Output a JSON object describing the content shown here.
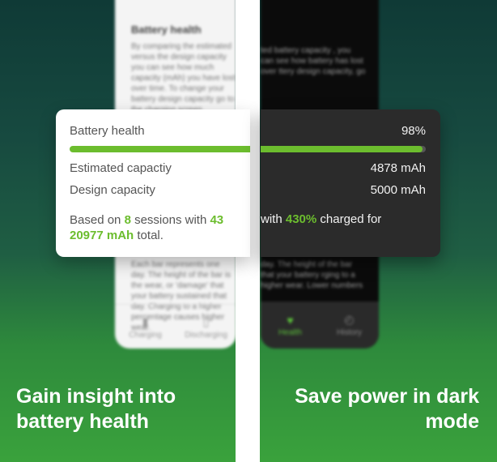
{
  "left_phone": {
    "doc_title": "Battery health",
    "doc_text": "By comparing the estimated versus the design capacity you can see how much capacity (mAh) you have lost over time. To change your battery design capacity go to the charging screen.",
    "doc_text_2": "Each bar represents one day. The height of the bar is the wear, or 'damage' that your battery sustained that day. Charging to a higher percentage causes higher wear.",
    "nav": [
      "Charging",
      "Discharging"
    ]
  },
  "right_phone": {
    "doc_text": "ted battery capacity , you can see how battery has lost over ttery design capacity, go",
    "doc_text_2": "day. The height of the bar that your battery rging to a higher wear. Lower numbers",
    "nav": [
      "Health",
      "History"
    ]
  },
  "card": {
    "title": "Battery health",
    "percent": "98%",
    "percent_value": 98,
    "estimated_label": "Estimated capactiy",
    "estimated_value": "4878 mAh",
    "design_label": "Design capacity",
    "design_value": "5000 mAh",
    "based_on": "Based on",
    "sessions_count": "8",
    "sessions_with": "sessions with",
    "partial_left": "43",
    "with_text": "with",
    "charged_pct": "430%",
    "charged_for": "charged for",
    "total_mah": "20977 mAh",
    "total_word": "total."
  },
  "captions": {
    "left": "Gain insight into battery health",
    "right": "Save power in dark mode"
  },
  "colors": {
    "accent": "#6cbd2e",
    "card_dark_bg": "#2b2b2b",
    "card_light_bg": "#ffffff"
  }
}
